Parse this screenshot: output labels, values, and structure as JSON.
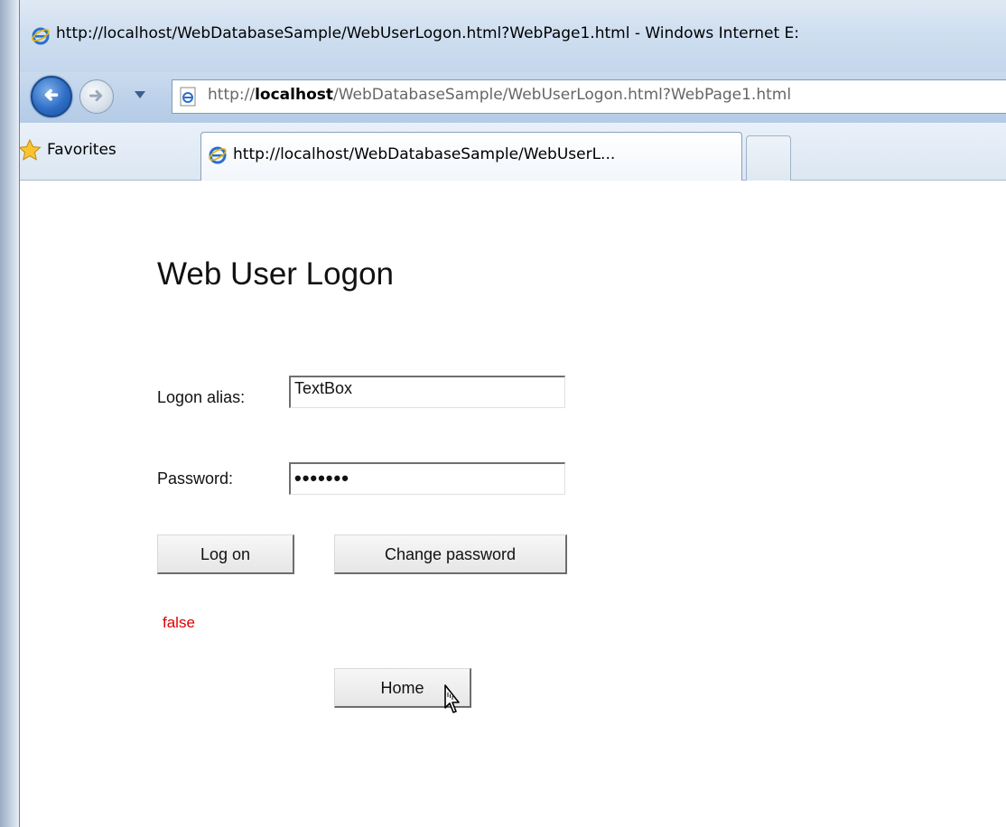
{
  "window": {
    "title": "http://localhost/WebDatabaseSample/WebUserLogon.html?WebPage1.html - Windows Internet E:"
  },
  "navigation": {
    "address_prefix": "http://",
    "address_host": "localhost",
    "address_rest": "/WebDatabaseSample/WebUserLogon.html?WebPage1.html"
  },
  "favorites": {
    "label": "Favorites"
  },
  "tabs": [
    {
      "label": "http://localhost/WebDatabaseSample/WebUserL..."
    }
  ],
  "page": {
    "title": "Web User Logon",
    "logon_alias_label": "Logon alias:",
    "logon_alias_value": "TextBox",
    "password_label": "Password:",
    "password_masked": "•••••••",
    "logon_button": "Log on",
    "change_password_button": "Change password",
    "status_text": "false",
    "home_button": "Home"
  },
  "colors": {
    "status_text": "#e00000",
    "browser_chrome": "#c3d6ec"
  },
  "icons": {
    "title": "ie-icon",
    "back": "back-arrow-icon",
    "forward": "forward-arrow-icon",
    "favorites": "star-icon",
    "cursor": "mouse-pointer-icon"
  }
}
